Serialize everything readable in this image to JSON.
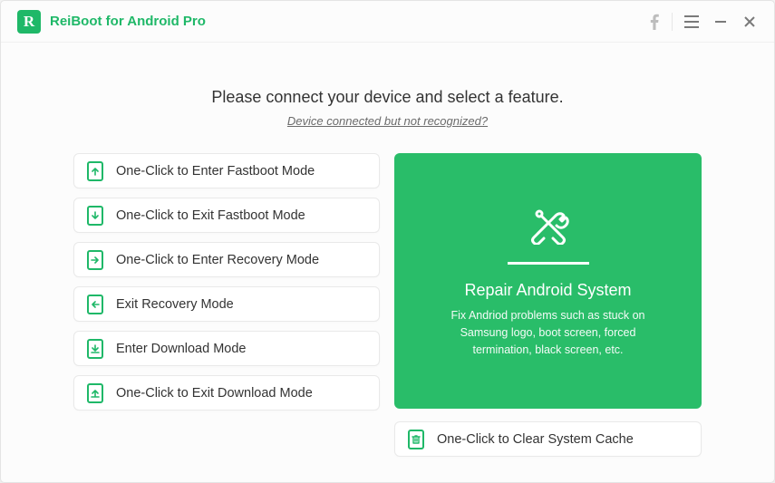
{
  "app": {
    "title": "ReiBoot for Android Pro",
    "logo_letter": "R"
  },
  "prompt": "Please connect your device and select a feature.",
  "help_link": "Device connected but not recognized?",
  "options": [
    {
      "label": "One-Click to Enter Fastboot Mode"
    },
    {
      "label": "One-Click to Exit Fastboot Mode"
    },
    {
      "label": "One-Click to Enter Recovery Mode"
    },
    {
      "label": "Exit Recovery Mode"
    },
    {
      "label": "Enter Download Mode"
    },
    {
      "label": "One-Click to Exit Download Mode"
    }
  ],
  "hero": {
    "title": "Repair Android System",
    "desc": "Fix Andriod problems such as stuck on Samsung logo, boot screen, forced termination, black screen, etc."
  },
  "cache": {
    "label": "One-Click to Clear System Cache"
  },
  "colors": {
    "accent": "#1fb868",
    "hero": "#29bd69"
  }
}
